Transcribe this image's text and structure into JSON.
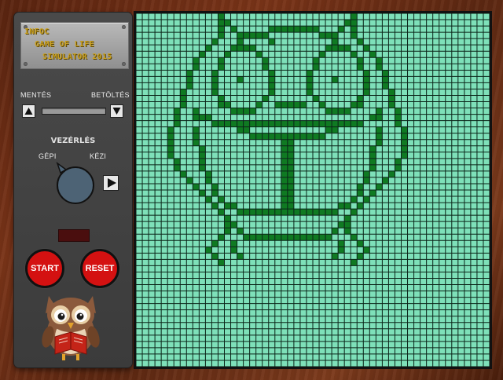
{
  "title": {
    "line1": "INFOC",
    "line2": "GAME OF LIFE",
    "line3": "SIMULATOR 2015"
  },
  "save_label": "MENTÉS",
  "load_label": "BETÖLTÉS",
  "control": {
    "heading": "VEZÉRLÉS",
    "auto_label": "GÉPI",
    "manual_label": "KÉZI"
  },
  "start_label": "START",
  "reset_label": "RESET",
  "colors": {
    "board": "#7ee0b9",
    "live_cell": "#0f7a22",
    "button_red": "#d41111"
  },
  "board": {
    "columns": 56,
    "rows": 56,
    "live_cells": [
      "0,13",
      "0,34",
      "1,13",
      "1,14",
      "1,33",
      "1,34",
      "2,13",
      "2,15",
      "2,21",
      "2,22",
      "2,23",
      "2,24",
      "2,25",
      "2,26",
      "2,27",
      "2,28",
      "2,32",
      "2,34",
      "3,13",
      "3,16",
      "3,17",
      "3,18",
      "3,19",
      "3,20",
      "3,29",
      "3,30",
      "3,31",
      "3,34",
      "4,12",
      "4,16",
      "4,21",
      "4,31",
      "4,35",
      "5,11",
      "5,15",
      "5,16",
      "5,17",
      "5,18",
      "5,30",
      "5,31",
      "5,32",
      "5,33",
      "5,36",
      "6,10",
      "6,14",
      "6,19",
      "6,29",
      "6,34",
      "6,37",
      "7,9",
      "7,13",
      "7,20",
      "7,28",
      "7,35",
      "7,38",
      "8,9",
      "8,13",
      "8,20",
      "8,28",
      "8,35",
      "8,38",
      "9,8",
      "9,12",
      "9,21",
      "9,27",
      "9,36",
      "9,39",
      "10,8",
      "10,12",
      "10,16",
      "10,21",
      "10,27",
      "10,31",
      "10,36",
      "10,39",
      "11,8",
      "11,12",
      "11,21",
      "11,27",
      "11,36",
      "11,39",
      "12,7",
      "12,12",
      "12,21",
      "12,27",
      "12,36",
      "12,40",
      "13,7",
      "13,13",
      "13,20",
      "13,28",
      "13,35",
      "13,40",
      "14,7",
      "14,13",
      "14,14",
      "14,19",
      "14,22",
      "14,23",
      "14,24",
      "14,25",
      "14,26",
      "14,29",
      "14,34",
      "14,35",
      "14,40",
      "15,6",
      "15,9",
      "15,15",
      "15,16",
      "15,17",
      "15,18",
      "15,30",
      "15,31",
      "15,32",
      "15,33",
      "15,38",
      "15,41",
      "16,6",
      "16,9",
      "16,10",
      "16,11",
      "16,37",
      "16,38",
      "16,41",
      "17,6",
      "17,12",
      "17,13",
      "17,14",
      "17,15",
      "17,16",
      "17,17",
      "17,18",
      "17,19",
      "17,20",
      "17,21",
      "17,22",
      "17,23",
      "17,24",
      "17,25",
      "17,26",
      "17,27",
      "17,28",
      "17,29",
      "17,30",
      "17,31",
      "17,32",
      "17,33",
      "17,34",
      "17,35",
      "17,41",
      "18,5",
      "18,9",
      "18,16",
      "18,17",
      "18,30",
      "18,31",
      "18,38",
      "18,42",
      "19,5",
      "19,9",
      "19,18",
      "19,19",
      "19,20",
      "19,21",
      "19,22",
      "19,23",
      "19,24",
      "19,25",
      "19,26",
      "19,27",
      "19,28",
      "19,29",
      "19,38",
      "19,42",
      "20,5",
      "20,9",
      "20,23",
      "20,24",
      "20,38",
      "20,42",
      "21,5",
      "21,10",
      "21,23",
      "21,24",
      "21,37",
      "21,42",
      "22,5",
      "22,10",
      "22,23",
      "22,24",
      "22,37",
      "22,42",
      "23,6",
      "23,10",
      "23,23",
      "23,24",
      "23,37",
      "23,41",
      "24,6",
      "24,10",
      "24,23",
      "24,24",
      "24,37",
      "24,41",
      "25,7",
      "25,11",
      "25,23",
      "25,24",
      "25,36",
      "25,40",
      "26,8",
      "26,11",
      "26,23",
      "26,24",
      "26,36",
      "26,39",
      "27,9",
      "27,12",
      "27,23",
      "27,24",
      "27,35",
      "27,38",
      "28,10",
      "28,12",
      "28,23",
      "28,24",
      "28,35",
      "28,37",
      "29,11",
      "29,13",
      "29,23",
      "29,24",
      "29,34",
      "29,36",
      "30,12",
      "30,14",
      "30,15",
      "30,23",
      "30,24",
      "30,32",
      "30,33",
      "30,35",
      "31,13",
      "31,16",
      "31,17",
      "31,18",
      "31,19",
      "31,20",
      "31,21",
      "31,22",
      "31,23",
      "31,24",
      "31,25",
      "31,26",
      "31,27",
      "31,28",
      "31,29",
      "31,30",
      "31,31",
      "31,34",
      "32,14",
      "32,33",
      "33,14",
      "33,15",
      "33,32",
      "33,33",
      "34,14",
      "34,16",
      "34,31",
      "34,33",
      "35,13",
      "35,17",
      "35,18",
      "35,19",
      "35,20",
      "35,21",
      "35,22",
      "35,23",
      "35,24",
      "35,25",
      "35,26",
      "35,27",
      "35,28",
      "35,29",
      "35,30",
      "35,34",
      "36,12",
      "36,15",
      "36,32",
      "36,35",
      "37,11",
      "37,15",
      "37,32",
      "37,36",
      "38,12",
      "38,16",
      "38,31",
      "38,35",
      "39,13",
      "39,34"
    ]
  }
}
